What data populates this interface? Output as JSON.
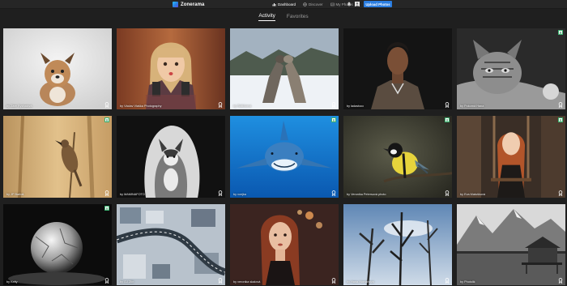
{
  "app": {
    "name": "Zonerama"
  },
  "nav": {
    "items": [
      {
        "label": "Dashboard",
        "icon": "chart-icon",
        "active": true
      },
      {
        "label": "Discover",
        "icon": "globe-icon",
        "active": false
      },
      {
        "label": "My Photos",
        "icon": "photo-icon",
        "active": false
      }
    ],
    "icons": [
      "bell-icon",
      "avatar-icon"
    ],
    "upload_label": "Upload Photos"
  },
  "tabs": [
    {
      "label": "Activity",
      "active": true
    },
    {
      "label": "Favorites",
      "active": false
    }
  ],
  "colors": {
    "accent": "#2a7de1",
    "background": "#1f1f1f",
    "topbar": "#262626"
  },
  "photos": [
    {
      "credit": "by Záre Rychalová",
      "subject": "puppy on grey backdrop",
      "badge": "award-icon"
    },
    {
      "credit": "by Václav Vlaška Photography",
      "subject": "blonde woman with hands on cheeks",
      "badge": "award-icon"
    },
    {
      "credit": "by Šidličková",
      "subject": "wolves playing in snow",
      "badge": "award-icon"
    },
    {
      "credit": "by ladastocc",
      "subject": "young man in coat",
      "badge": "award-icon"
    },
    {
      "credit": "by Pokorná Hana",
      "subject": "black and white cat",
      "badge": "award-icon",
      "extra_badge": "X"
    },
    {
      "credit": "by JP Bartoš",
      "subject": "bird on reed",
      "badge": "award-icon",
      "extra_badge": "X"
    },
    {
      "credit": "by MAMINAFOTO",
      "subject": "husky in cave",
      "badge": "award-icon"
    },
    {
      "credit": "by vcejka",
      "subject": "shark underwater",
      "badge": "award-icon",
      "extra_badge": "X"
    },
    {
      "credit": "by Veronika Petersová photo",
      "subject": "great tit on branch",
      "badge": "award-icon",
      "extra_badge": "X"
    },
    {
      "credit": "by Eva Matušková",
      "subject": "redhead woman on swing",
      "badge": "award-icon",
      "extra_badge": "X"
    },
    {
      "credit": "by Keity",
      "subject": "frozen bubble",
      "badge": "award-icon",
      "extra_badge": "X"
    },
    {
      "credit": "by OJ Zlín",
      "subject": "aerial road in winter",
      "badge": "award-icon"
    },
    {
      "credit": "by veronika skalová",
      "subject": "portrait of woman with bokeh",
      "badge": "award-icon"
    },
    {
      "credit": "by Hana Hornaňová",
      "subject": "trees against sky",
      "badge": "award-icon"
    },
    {
      "credit": "by Photolik",
      "subject": "cabin by mountain lake",
      "badge": "award-icon"
    }
  ]
}
